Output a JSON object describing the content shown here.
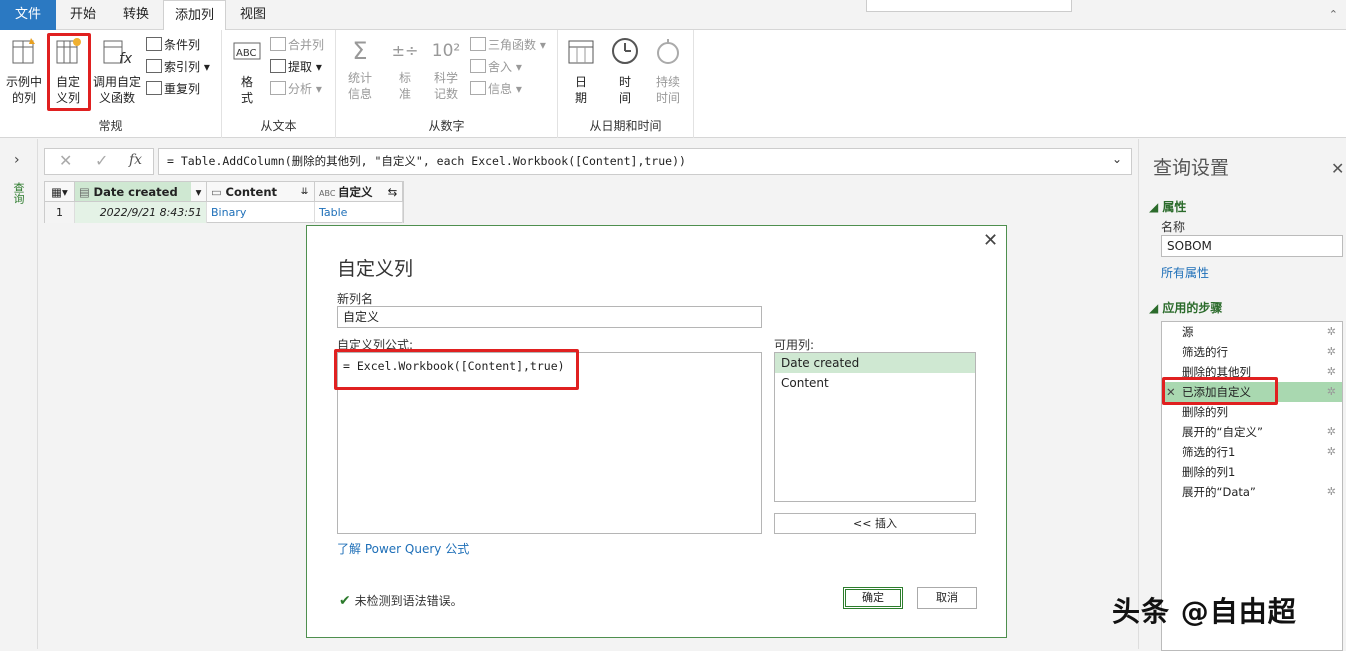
{
  "tabs": {
    "file": "文件",
    "home": "开始",
    "transform": "转换",
    "add_column": "添加列",
    "view": "视图"
  },
  "ribbon": {
    "general": {
      "label": "常规",
      "column_from_examples": "示例中\n的列",
      "custom_column": "自定\n义列",
      "invoke_custom_function": "调用自定\n义函数",
      "conditional_column": "条件列",
      "index_column": "索引列",
      "duplicate_column": "重复列"
    },
    "from_text": {
      "label": "从文本",
      "format": "格\n式",
      "merge_columns": "合并列",
      "extract": "提取",
      "parse": "分析"
    },
    "from_number": {
      "label": "从数字",
      "statistics": "统计\n信息",
      "standard": "标\n准",
      "scientific": "科学\n记数",
      "trigonometry": "三角函数",
      "rounding": "舍入",
      "information": "信息"
    },
    "from_datetime": {
      "label": "从日期和时间",
      "date": "日\n期",
      "time": "时\n间",
      "duration": "持续\n时间"
    }
  },
  "left_pane": {
    "queries_label": "查询"
  },
  "formula_bar": {
    "text": "= Table.AddColumn(删除的其他列, \"自定义\", each Excel.Workbook([Content],true))"
  },
  "grid": {
    "columns": [
      "Date created",
      "Content",
      "自定义"
    ],
    "row_number": "1",
    "rows": [
      [
        "2022/9/21 8:43:51",
        "Binary",
        "Table"
      ]
    ]
  },
  "dialog": {
    "title": "自定义列",
    "new_column_label": "新列名",
    "new_column_value": "自定义",
    "formula_label": "自定义列公式:",
    "formula": "= Excel.Workbook([Content],true)",
    "available_label": "可用列:",
    "available_columns": [
      "Date created",
      "Content"
    ],
    "insert_button": "<< 插入",
    "learn_link": "了解 Power Query 公式",
    "status": "未检测到语法错误。",
    "ok_button": "确定",
    "cancel_button": "取消"
  },
  "settings": {
    "title": "查询设置",
    "properties_header": "属性",
    "name_label": "名称",
    "name_value": "SOBOM",
    "all_properties": "所有属性",
    "steps_header": "应用的步骤",
    "steps": [
      "源",
      "筛选的行",
      "删除的其他列",
      "已添加自定义",
      "删除的列",
      "展开的“自定义”",
      "筛选的行1",
      "删除的列1",
      "展开的“Data”"
    ]
  },
  "watermark": "头条 @自由超",
  "colors": {
    "accent_green": "#2b7a2b",
    "selected_green": "#a9d8b0",
    "file_tab_blue": "#2b79c2",
    "highlight_red": "#e02020"
  }
}
